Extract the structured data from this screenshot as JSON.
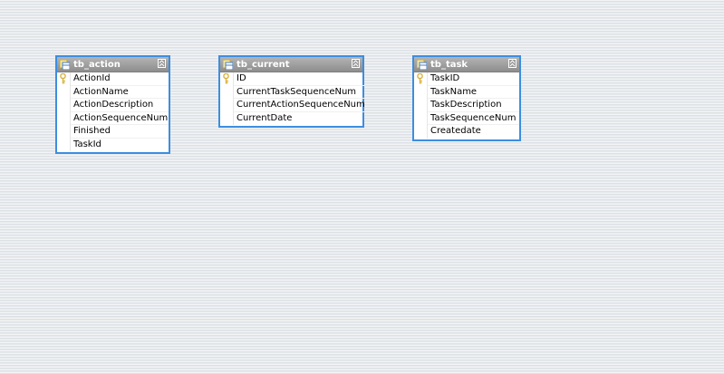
{
  "tables": [
    {
      "name": "tb_action",
      "fields": [
        "ActionId",
        "ActionName",
        "ActionDescription",
        "ActionSequenceNum",
        "Finished",
        "TaskId"
      ],
      "primary_key_index": 0
    },
    {
      "name": "tb_current",
      "fields": [
        "ID",
        "CurrentTaskSequenceNum",
        "CurrentActionSequenceNum",
        "CurrentDate"
      ],
      "primary_key_index": 0
    },
    {
      "name": "tb_task",
      "fields": [
        "TaskID",
        "TaskName",
        "TaskDescription",
        "TaskSequenceNum",
        "Createdate"
      ],
      "primary_key_index": 0
    }
  ],
  "icons": {
    "table": "table-icon",
    "collapse": "collapse-icon",
    "key": "key-icon"
  },
  "colors": {
    "border": "#3c8ee0",
    "header_top": "#b4b4b4",
    "header_bottom": "#8d8d8d",
    "key": "#d7b23a"
  }
}
